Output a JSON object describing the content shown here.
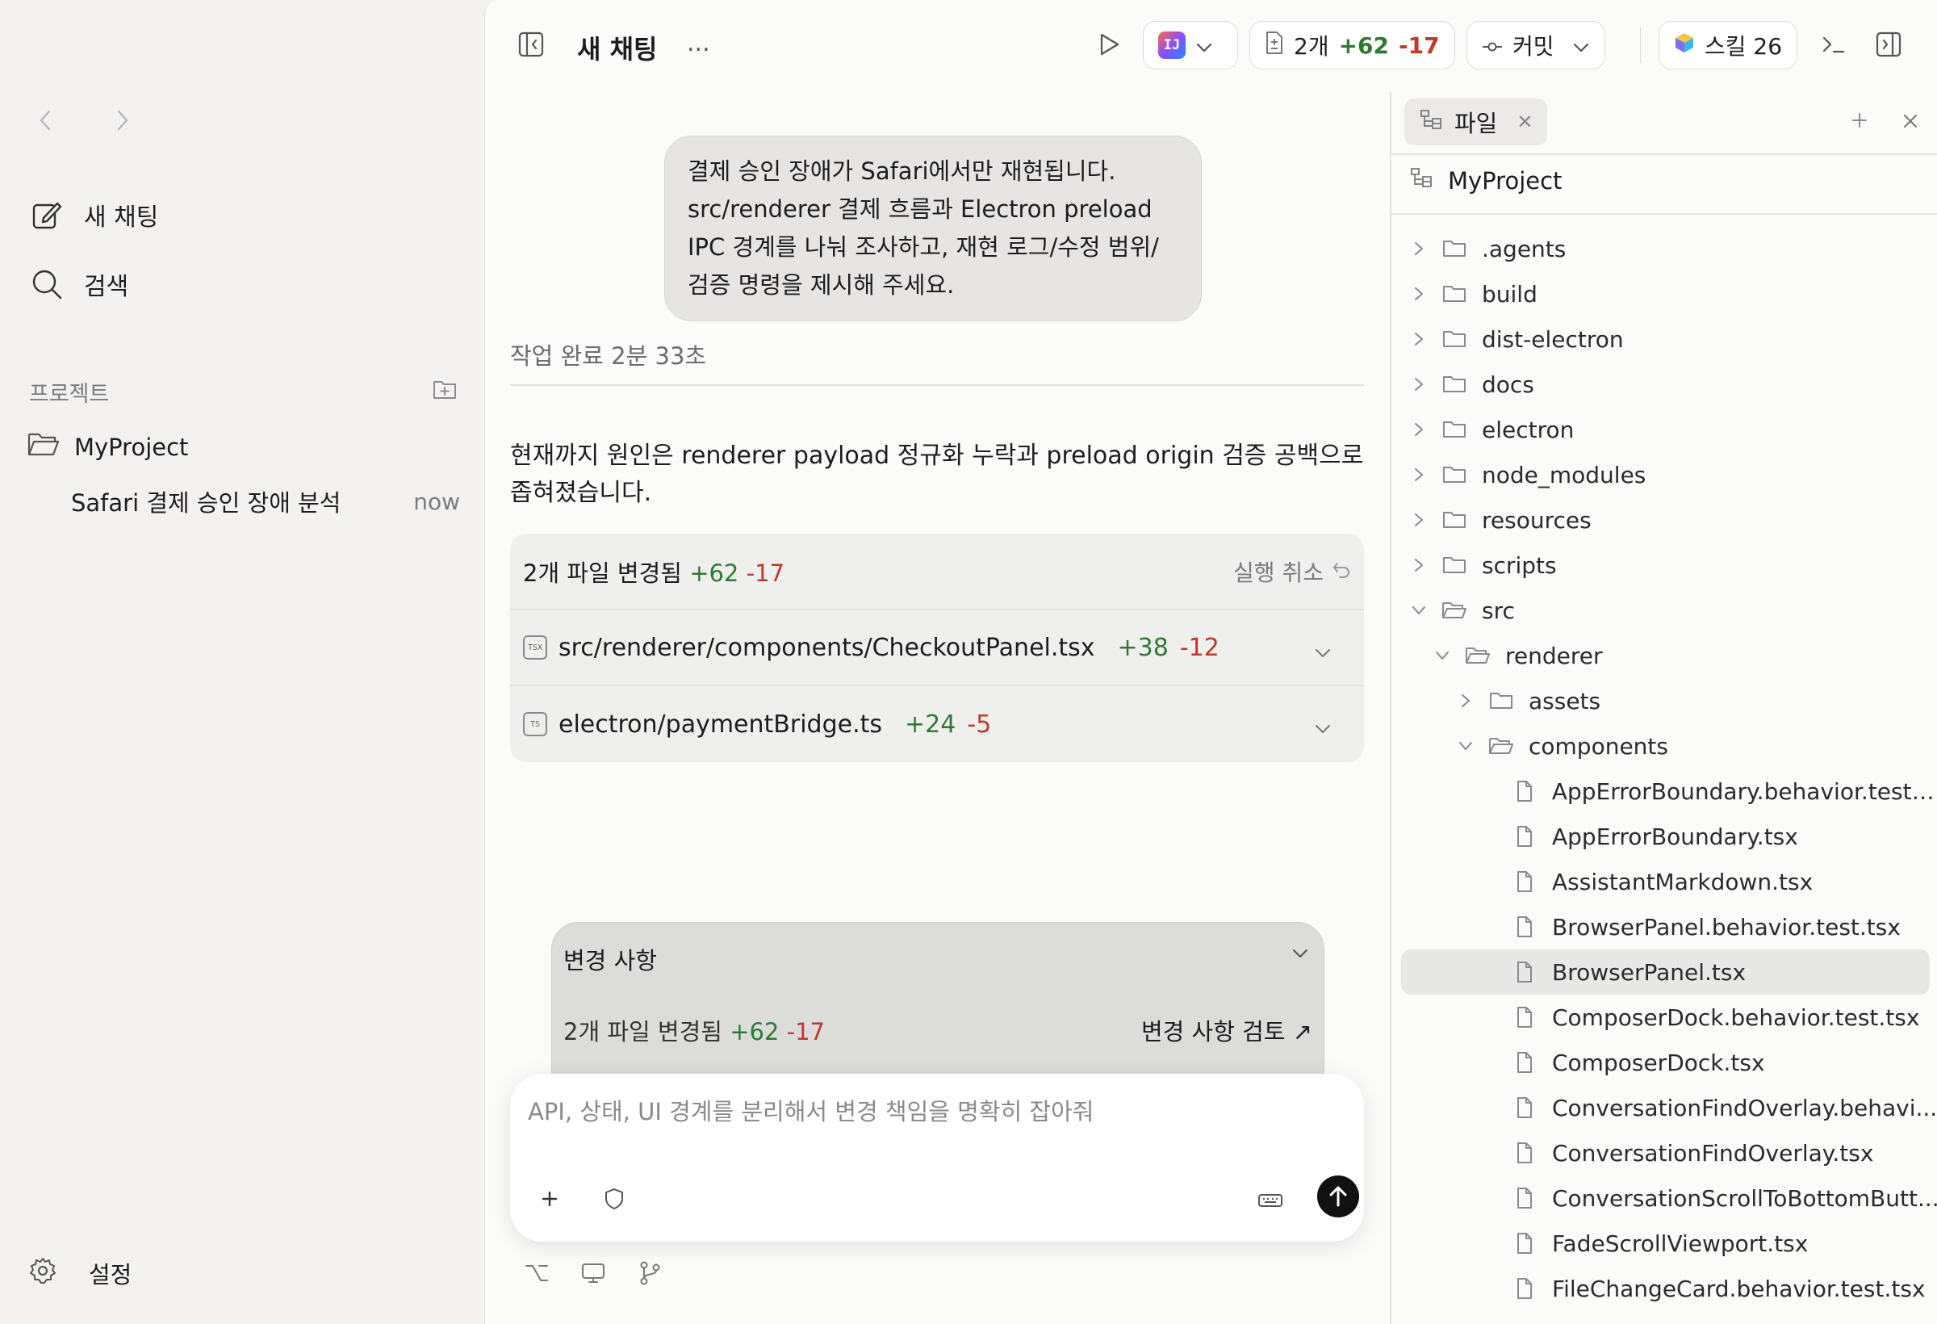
{
  "sidebar": {
    "new_chat": "새 채팅",
    "search": "검색",
    "projects_heading": "프로젝트",
    "project_name": "MyProject",
    "thread_title": "Safari 결제 승인 장애 분석",
    "thread_time": "now",
    "settings": "설정"
  },
  "topbar": {
    "title": "새 채팅",
    "more": "...",
    "ide_badge": "IJ",
    "diff_count": "2개",
    "diff_plus": "+62",
    "diff_minus": "-17",
    "commit": "커밋",
    "skills": "스킬 26"
  },
  "chat": {
    "user_message": "결제 승인 장애가 Safari에서만 재현됩니다. src/renderer 결제 흐름과 Electron preload IPC 경계를 나눠 조사하고, 재현 로그/수정 범위/검증 명령을 제시해 주세요.",
    "worked_for": "작업 완료 2분 33초",
    "answer": "현재까지 원인은 renderer payload 정규화 누락과 preload origin 검증 공백으로 좁혀졌습니다.",
    "changes": {
      "summary": "2개 파일 변경됨",
      "plus": "+62",
      "minus": "-17",
      "undo": "실행 취소",
      "files": [
        {
          "type": "TSX",
          "path": "src/renderer/components/CheckoutPanel.tsx",
          "plus": "+38",
          "minus": "-12"
        },
        {
          "type": "TS",
          "path": "electron/paymentBridge.ts",
          "plus": "+24",
          "minus": "-5"
        }
      ]
    }
  },
  "review": {
    "title": "변경 사항",
    "summary": "2개 파일 변경됨",
    "plus": "+62",
    "minus": "-17",
    "link": "변경 사항 검토 ↗"
  },
  "composer": {
    "placeholder": "API, 상태, UI 경계를 분리해서 변경 책임을 명확히 잡아줘"
  },
  "files_panel": {
    "tab_label": "파일",
    "root": "MyProject",
    "tree": [
      {
        "name": ".agents",
        "kind": "folder",
        "depth": 0,
        "open": false
      },
      {
        "name": "build",
        "kind": "folder",
        "depth": 0,
        "open": false
      },
      {
        "name": "dist-electron",
        "kind": "folder",
        "depth": 0,
        "open": false
      },
      {
        "name": "docs",
        "kind": "folder",
        "depth": 0,
        "open": false
      },
      {
        "name": "electron",
        "kind": "folder",
        "depth": 0,
        "open": false
      },
      {
        "name": "node_modules",
        "kind": "folder",
        "depth": 0,
        "open": false
      },
      {
        "name": "resources",
        "kind": "folder",
        "depth": 0,
        "open": false
      },
      {
        "name": "scripts",
        "kind": "folder",
        "depth": 0,
        "open": false
      },
      {
        "name": "src",
        "kind": "folder",
        "depth": 0,
        "open": true
      },
      {
        "name": "renderer",
        "kind": "folder",
        "depth": 1,
        "open": true
      },
      {
        "name": "assets",
        "kind": "folder",
        "depth": 2,
        "open": false
      },
      {
        "name": "components",
        "kind": "folder",
        "depth": 2,
        "open": true
      },
      {
        "name": "AppErrorBoundary.behavior.test....",
        "kind": "file",
        "depth": 3
      },
      {
        "name": "AppErrorBoundary.tsx",
        "kind": "file",
        "depth": 3
      },
      {
        "name": "AssistantMarkdown.tsx",
        "kind": "file",
        "depth": 3
      },
      {
        "name": "BrowserPanel.behavior.test.tsx",
        "kind": "file",
        "depth": 3
      },
      {
        "name": "BrowserPanel.tsx",
        "kind": "file",
        "depth": 3,
        "selected": true
      },
      {
        "name": "ComposerDock.behavior.test.tsx",
        "kind": "file",
        "depth": 3
      },
      {
        "name": "ComposerDock.tsx",
        "kind": "file",
        "depth": 3
      },
      {
        "name": "ConversationFindOverlay.behavi...",
        "kind": "file",
        "depth": 3
      },
      {
        "name": "ConversationFindOverlay.tsx",
        "kind": "file",
        "depth": 3
      },
      {
        "name": "ConversationScrollToBottomButt...",
        "kind": "file",
        "depth": 3
      },
      {
        "name": "FadeScrollViewport.tsx",
        "kind": "file",
        "depth": 3
      },
      {
        "name": "FileChangeCard.behavior.test.tsx",
        "kind": "file",
        "depth": 3
      }
    ]
  }
}
